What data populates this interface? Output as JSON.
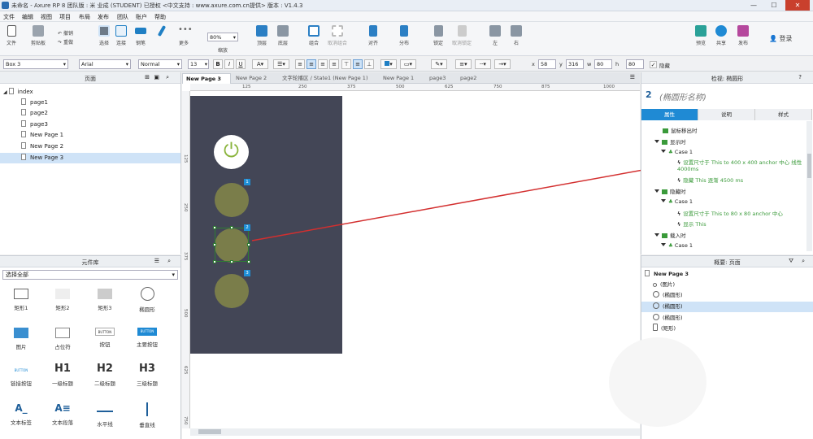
{
  "window": {
    "title": "未命名 - Axure RP 8 团队版 : 米 业成 (STUDENT) 已授权    <中文支持 : www.axure.com.cn提供> 版本 : V1.4.3",
    "minimize": "—",
    "maximize": "☐",
    "close": "✕"
  },
  "menu": [
    "文件",
    "编辑",
    "视图",
    "项目",
    "布局",
    "发布",
    "团队",
    "账户",
    "帮助"
  ],
  "toolbar": {
    "file": "文件",
    "clipboard": "剪贴板",
    "undo": "撤销",
    "redo": "重做",
    "select": "选择",
    "connect": "连接",
    "pen": "钢笔",
    "more": "更多",
    "zoom": "80%",
    "zoom_label": "缩放",
    "top": "顶层",
    "bottom": "底层",
    "group": "组合",
    "ungroup": "取消组合",
    "align": "对齐",
    "distribute": "分布",
    "lock": "锁定",
    "unlock": "取消锁定",
    "left": "左",
    "right": "右",
    "preview": "预览",
    "share": "共享",
    "publish": "发布",
    "login": "登录"
  },
  "formatbar": {
    "widget_name": "Box 3",
    "font": "Arial",
    "weight": "Normal",
    "size": "13",
    "bold": "B",
    "italic": "I",
    "underline": "U",
    "x_label": "x",
    "x": "58",
    "y_label": "y",
    "y": "316",
    "w_label": "w",
    "w": "80",
    "h_label": "h",
    "h": "80",
    "hidden": "隐藏"
  },
  "pages": {
    "title": "页面",
    "items": [
      {
        "label": "index",
        "selected": false,
        "root": true
      },
      {
        "label": "page1",
        "selected": false
      },
      {
        "label": "page2",
        "selected": false
      },
      {
        "label": "page3",
        "selected": false
      },
      {
        "label": "New Page 1",
        "selected": false
      },
      {
        "label": "New Page 2",
        "selected": false
      },
      {
        "label": "New Page 3",
        "selected": true
      }
    ]
  },
  "library": {
    "title": "元件库",
    "filter": "选择全部",
    "widgets": [
      "矩形1",
      "矩形2",
      "矩形3",
      "椭圆形",
      "图片",
      "占位符",
      "按钮",
      "主要按钮",
      "链接按钮",
      "一级标题",
      "二级标题",
      "三级标题",
      "文本标签",
      "文本段落",
      "水平线",
      "垂直线"
    ],
    "button_text": "BUTTON",
    "h1": "H1",
    "h2": "H2",
    "h3": "H3",
    "label_glyph": "A_",
    "para_glyph": "A≡"
  },
  "tabs": [
    "New Page 3",
    "New Page 2",
    "文字轮播区 / State1 (New Page 1)",
    "New Page 1",
    "page3",
    "page2"
  ],
  "ruler": {
    "h": [
      "125",
      "250",
      "375",
      "500",
      "625",
      "750",
      "875",
      "1000"
    ],
    "v": [
      "125",
      "250",
      "375",
      "500",
      "625",
      "750"
    ]
  },
  "canvas": {
    "badges": [
      "1",
      "2",
      "3"
    ],
    "power_glyph": "⏻",
    "colors": {
      "artboard": "#434656",
      "circle": "#7a7d4a",
      "power": "#8ab43c"
    }
  },
  "inspector": {
    "header": "检视: 椭圆形",
    "number": "2",
    "name_placeholder": "(椭圆形名称)",
    "tabs": [
      "属性",
      "说明",
      "样式"
    ],
    "events": [
      {
        "text": "鼠标移出时",
        "kind": "event",
        "indent": 1
      },
      {
        "text": "显示时",
        "kind": "event",
        "indent": 1
      },
      {
        "text": "Case 1",
        "kind": "case",
        "indent": 2
      },
      {
        "text": "设置尺寸于 This to 400 x 400 anchor 中心 线性 4000ms",
        "kind": "action",
        "indent": 3
      },
      {
        "text": "隐藏 This 逐渐 4500 ms",
        "kind": "action",
        "indent": 3
      },
      {
        "text": "隐藏时",
        "kind": "event",
        "indent": 1
      },
      {
        "text": "Case 1",
        "kind": "case",
        "indent": 2
      },
      {
        "text": "设置尺寸于 This to 80 x 80 anchor 中心",
        "kind": "action",
        "indent": 3
      },
      {
        "text": "显示 This",
        "kind": "action",
        "indent": 3
      },
      {
        "text": "载入时",
        "kind": "event",
        "indent": 1
      },
      {
        "text": "Case 1",
        "kind": "case",
        "indent": 2
      }
    ]
  },
  "outline": {
    "title": "概要: 页面",
    "page": "New Page 3",
    "items": [
      {
        "label": "(图片)",
        "selected": false
      },
      {
        "label": "(椭圆形)",
        "selected": false
      },
      {
        "label": "(椭圆形)",
        "selected": true
      },
      {
        "label": "(椭圆形)",
        "selected": false
      },
      {
        "label": "(矩形)",
        "selected": false
      }
    ]
  }
}
